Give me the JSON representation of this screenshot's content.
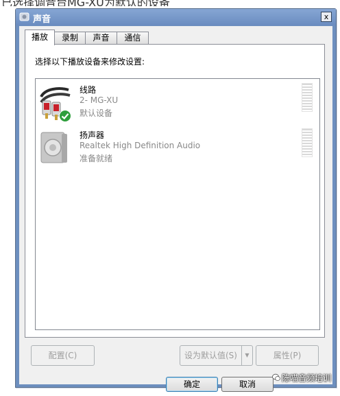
{
  "page_caption": "已选择调音台MG-XU为默认的设备",
  "window": {
    "title": "声音",
    "close_label": "x"
  },
  "tabs": [
    {
      "label": "播放",
      "active": true
    },
    {
      "label": "录制",
      "active": false
    },
    {
      "label": "声音",
      "active": false
    },
    {
      "label": "通信",
      "active": false
    }
  ],
  "panel": {
    "instruction": "选择以下播放设备来修改设置:"
  },
  "devices": [
    {
      "name": "线路",
      "line2": "2- MG-XU",
      "line3": "默认设备",
      "icon": "rca-cable-icon",
      "is_default": true
    },
    {
      "name": "扬声器",
      "line2": "Realtek High Definition Audio",
      "line3": "准备就绪",
      "icon": "speaker-icon",
      "is_default": false
    }
  ],
  "buttons": {
    "configure": "配置(C)",
    "set_default": "设为默认值(S)",
    "set_default_arrow": "▼",
    "properties": "属性(P)",
    "ok": "确定",
    "cancel": "取消"
  },
  "watermark": {
    "text": "陈喵音频培训"
  }
}
